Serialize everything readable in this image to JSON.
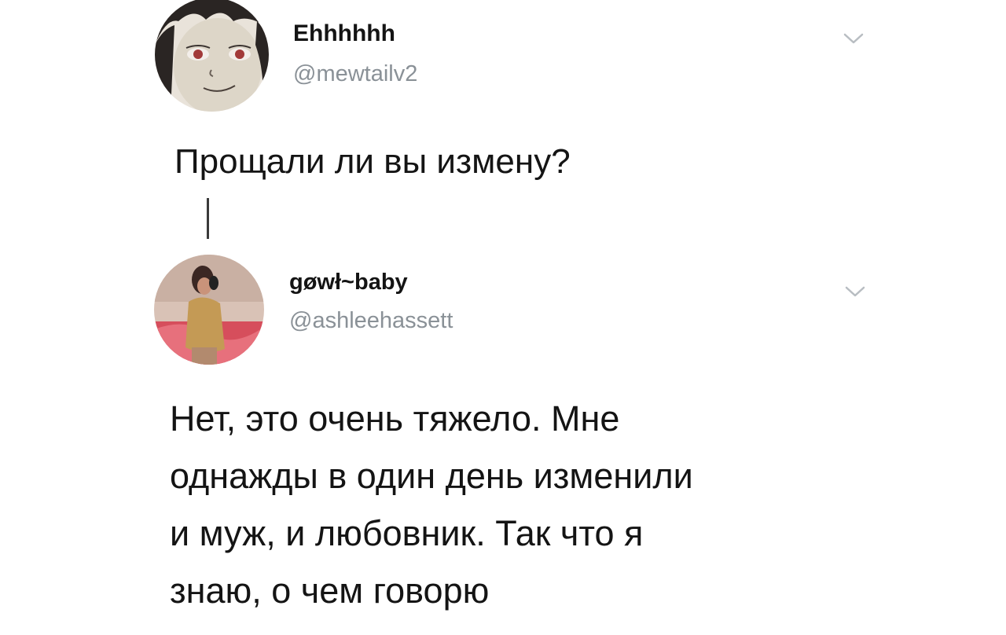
{
  "tweets": [
    {
      "display_name": "Ehhhhhh",
      "handle": "@mewtailv2",
      "text_lines": [
        "Прощали ли вы измену?"
      ],
      "avatar_icon": "anime-avatar-icon"
    },
    {
      "display_name": "gøwł~baby",
      "handle": "@ashleehassett",
      "text_lines": [
        "Нет, это очень тяжело. Мне",
        "однажды в один день изменили",
        "и муж, и любовник. Так что я",
        "знаю, о чем говорю"
      ],
      "avatar_icon": "photo-avatar-icon"
    }
  ],
  "icons": {
    "caret": "chevron-down-icon"
  },
  "colors": {
    "text": "#141414",
    "handle": "#8a9197",
    "caret": "#b8bdc2",
    "background": "#ffffff"
  }
}
